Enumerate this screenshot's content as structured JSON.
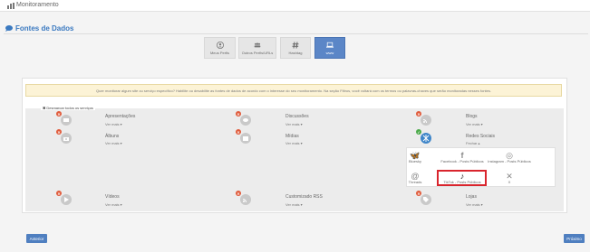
{
  "header": {
    "title": "Monitoramento"
  },
  "section": {
    "title": "Fontes de Dados"
  },
  "tabs": [
    {
      "label": "Meus Perfis",
      "icon": "user-icon",
      "active": false
    },
    {
      "label": "Outros Perfis/URLs",
      "icon": "users-icon",
      "active": false
    },
    {
      "label": "Hashtag",
      "icon": "hashtag-icon",
      "active": false
    },
    {
      "label": "www",
      "icon": "laptop-icon",
      "active": true
    }
  ],
  "alert": {
    "text": "Quer monitorar algum site ou serviço específico? Habilite ou desabilite as fontes de dados de acordo com o interesse do seu monitoramento. Na seção Filtros, você voltará com os termos ou palavras-chaves que serão monitoradas nesses fontes."
  },
  "deselect": {
    "label": "Desmarcar todos os serviços"
  },
  "services": [
    {
      "name": "Apresentações",
      "more": "Ver mais ▾",
      "enabled": false
    },
    {
      "name": "Discussões",
      "more": "Ver mais ▾",
      "enabled": false
    },
    {
      "name": "Blogs",
      "more": "Ver mais ▾",
      "enabled": false
    },
    {
      "name": "Álbuns",
      "more": "Ver mais ▾",
      "enabled": false
    },
    {
      "name": "Mídias",
      "more": "Ver mais ▾",
      "enabled": false
    },
    {
      "name": "Redes Sociais",
      "more": "Fechar ▴",
      "enabled": true
    },
    {
      "name": "Vídeos",
      "more": "Ver mais ▾",
      "enabled": false
    },
    {
      "name": "Customizado RSS",
      "more": "Ver mais ▾",
      "enabled": false
    },
    {
      "name": "Lojas",
      "more": "Ver mais ▾",
      "enabled": false
    }
  ],
  "social_networks": [
    {
      "label": "Bluesky",
      "icon": "bluesky-icon",
      "glyph": "🦋"
    },
    {
      "label": "Facebook - Posts Públicos",
      "icon": "facebook-icon",
      "glyph": "f"
    },
    {
      "label": "Instagram - Posts Públicos",
      "icon": "instagram-icon",
      "glyph": "◎"
    },
    {
      "label": "Threads",
      "icon": "threads-icon",
      "glyph": "@"
    },
    {
      "label": "TikTok - Posts Públicos",
      "icon": "tiktok-icon",
      "glyph": "♪"
    },
    {
      "label": "X",
      "icon": "x-icon",
      "glyph": "✕"
    }
  ],
  "buttons": {
    "back": "Anterior",
    "next": "Próximo"
  },
  "colors": {
    "accent": "#5b86c7",
    "disabled_badge": "#e05a3a",
    "enabled_badge": "#4caa4a",
    "highlight": "#d9252d"
  }
}
